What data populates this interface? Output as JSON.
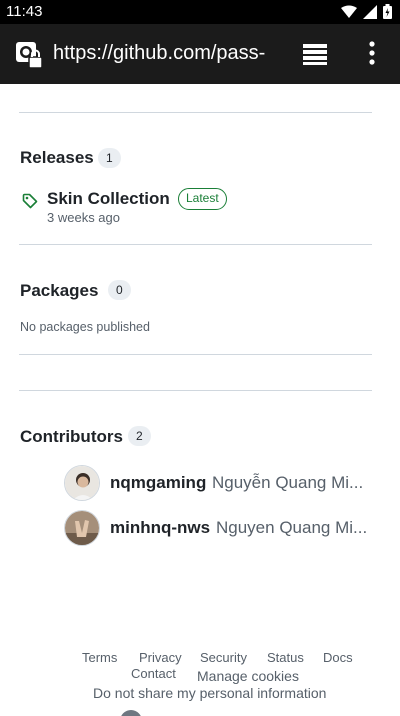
{
  "status_bar": {
    "time": "11:43"
  },
  "browser": {
    "url": "https://github.com/pass-"
  },
  "releases": {
    "title": "Releases",
    "count": "1",
    "item": {
      "name": "Skin Collection",
      "badge": "Latest",
      "date": "3 weeks ago"
    }
  },
  "packages": {
    "title": "Packages",
    "count": "0",
    "empty_text": "No packages published"
  },
  "contributors": {
    "title": "Contributors",
    "count": "2",
    "list": [
      {
        "login": "nqmgaming",
        "name": "Nguyễn Quang Mi..."
      },
      {
        "login": "minhnq-nws",
        "name": "Nguyen Quang Mi..."
      }
    ]
  },
  "footer": {
    "terms": "Terms",
    "privacy": "Privacy",
    "security": "Security",
    "status": "Status",
    "docs": "Docs",
    "contact": "Contact",
    "manage_cookies": "Manage cookies",
    "do_not_share": "Do not share my personal information"
  }
}
